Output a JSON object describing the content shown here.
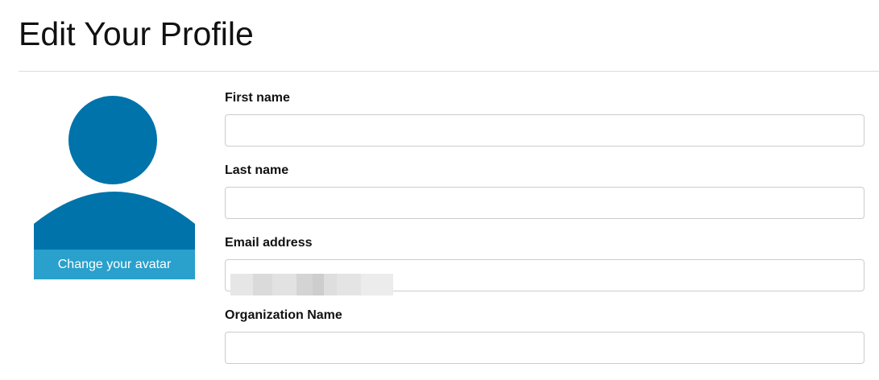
{
  "page": {
    "title": "Edit Your Profile"
  },
  "avatar": {
    "icon": "user-silhouette-icon",
    "color": "#0073aa",
    "button_label": "Change your avatar",
    "button_color": "#2aa0cc"
  },
  "form": {
    "first_name": {
      "label": "First name",
      "value": ""
    },
    "last_name": {
      "label": "Last name",
      "value": ""
    },
    "email": {
      "label": "Email address",
      "value": ""
    },
    "organization": {
      "label": "Organization Name",
      "value": ""
    }
  }
}
